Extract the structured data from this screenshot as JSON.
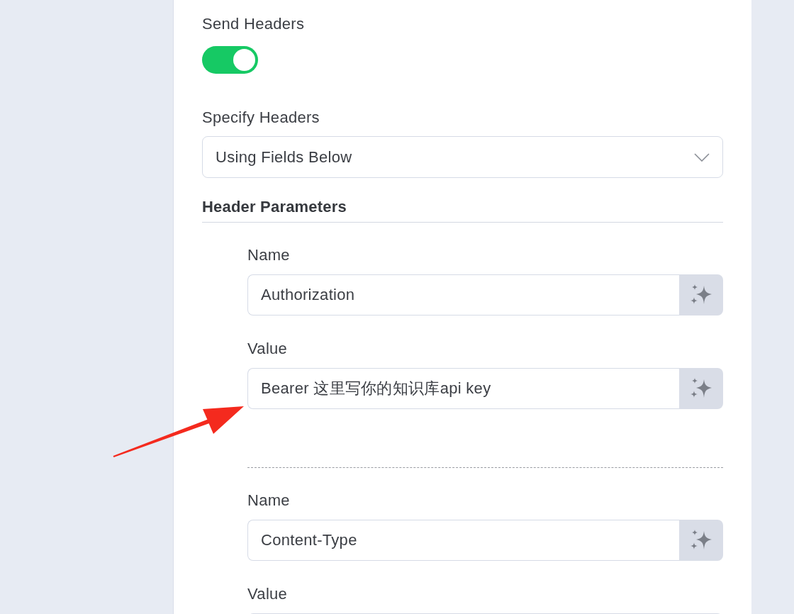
{
  "send_headers": {
    "label": "Send Headers",
    "on": true
  },
  "specify_headers": {
    "label": "Specify Headers",
    "value": "Using Fields Below"
  },
  "header_parameters": {
    "title": "Header Parameters",
    "items": [
      {
        "name_label": "Name",
        "name": "Authorization",
        "value_label": "Value",
        "value": "Bearer 这里写你的知识库api key"
      },
      {
        "name_label": "Name",
        "name": "Content-Type",
        "value_label": "Value"
      }
    ]
  }
}
